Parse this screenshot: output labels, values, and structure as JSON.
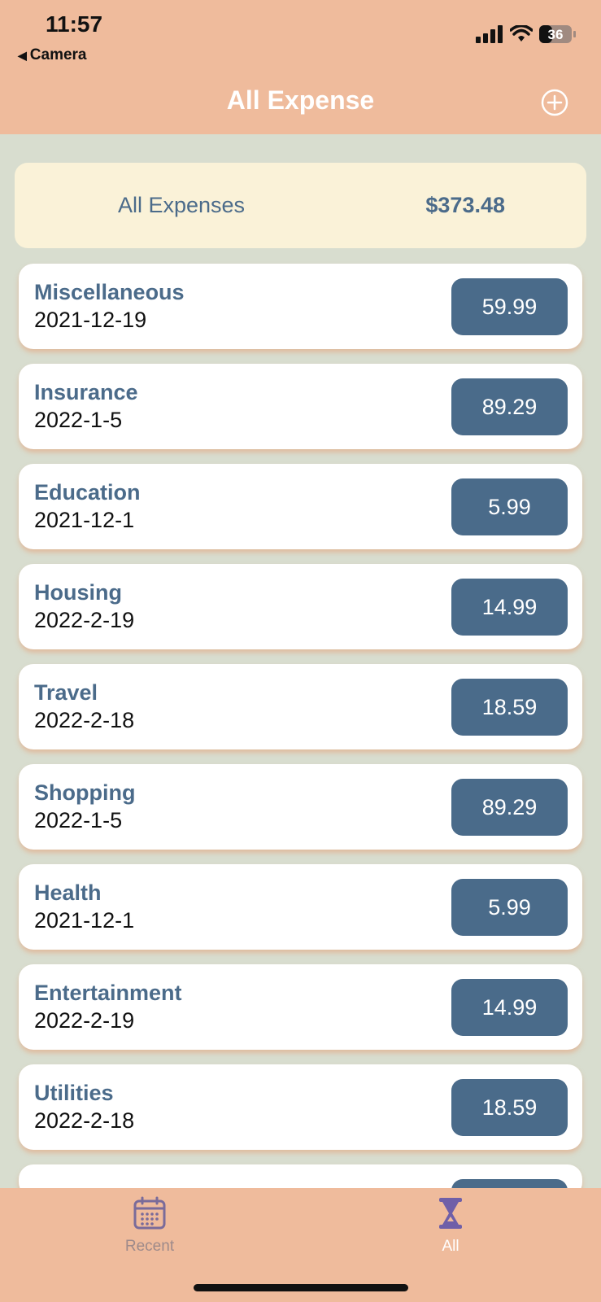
{
  "status": {
    "time": "11:57",
    "back_app": "Camera",
    "battery": "36"
  },
  "nav": {
    "title": "All Expense",
    "add_icon": "plus-circle-icon"
  },
  "summary": {
    "label": "All Expenses",
    "total": "$373.48"
  },
  "expenses": [
    {
      "category": "Miscellaneous",
      "date": "2021-12-19",
      "amount": "59.99"
    },
    {
      "category": "Insurance",
      "date": "2022-1-5",
      "amount": "89.29"
    },
    {
      "category": "Education",
      "date": "2021-12-1",
      "amount": "5.99"
    },
    {
      "category": "Housing",
      "date": "2022-2-19",
      "amount": "14.99"
    },
    {
      "category": "Travel",
      "date": "2022-2-18",
      "amount": "18.59"
    },
    {
      "category": "Shopping",
      "date": "2022-1-5",
      "amount": "89.29"
    },
    {
      "category": "Health",
      "date": "2021-12-1",
      "amount": "5.99"
    },
    {
      "category": "Entertainment",
      "date": "2022-2-19",
      "amount": "14.99"
    },
    {
      "category": "Utilities",
      "date": "2022-2-18",
      "amount": "18.59"
    }
  ],
  "tabs": {
    "recent": {
      "label": "Recent",
      "icon": "calendar-icon"
    },
    "all": {
      "label": "All",
      "icon": "hourglass-icon"
    }
  },
  "colors": {
    "header": "#efbb9c",
    "background": "#d8ddcf",
    "accent": "#4a6b8a",
    "summary_bg": "#faf2d8"
  }
}
